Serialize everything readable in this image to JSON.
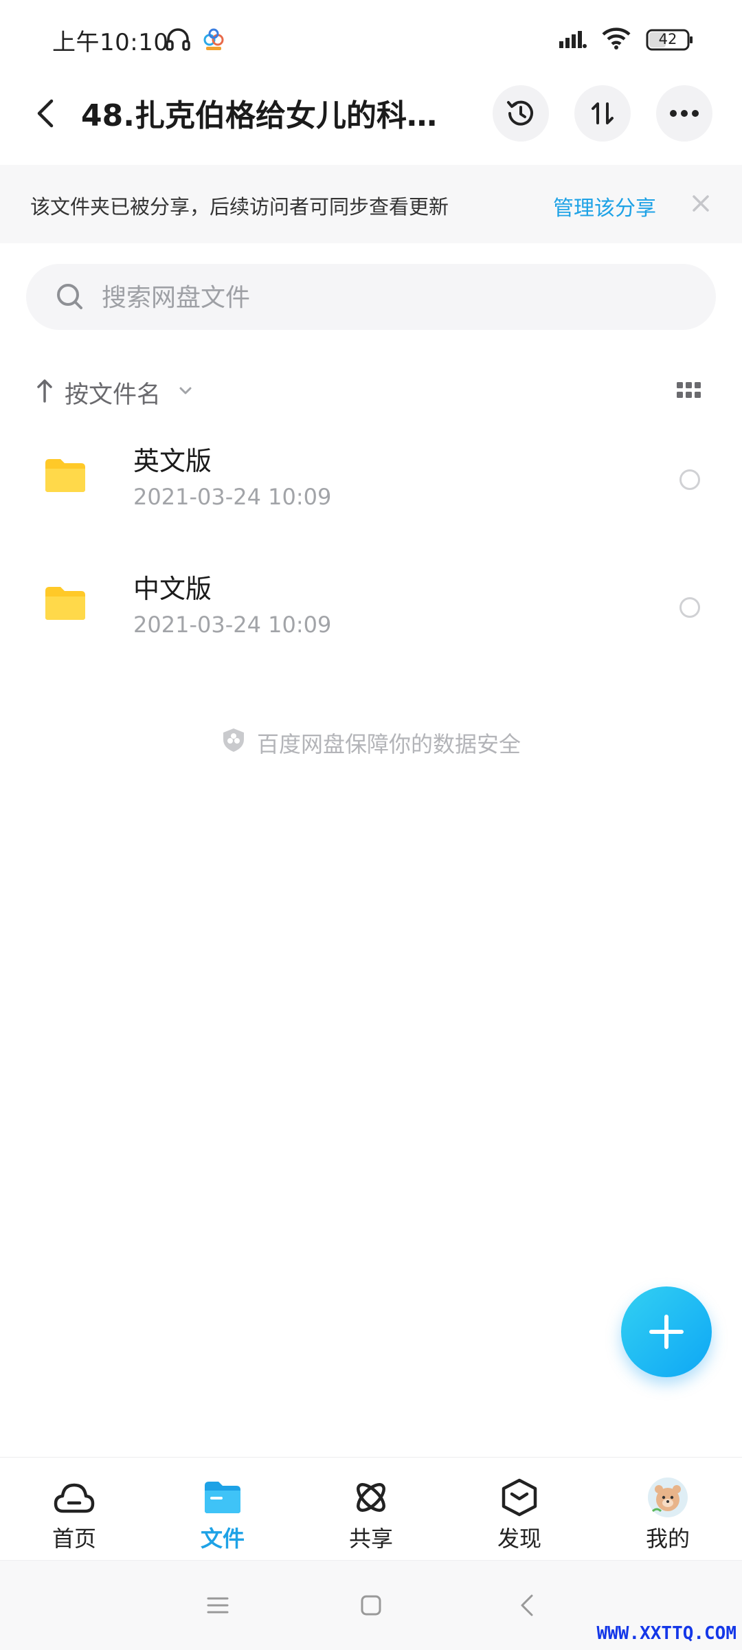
{
  "status_bar": {
    "time": "上午10:10",
    "battery": "42"
  },
  "header": {
    "title": "48.扎克伯格给女儿的科..."
  },
  "share_banner": {
    "text": "该文件夹已被分享，后续访问者可同步查看更新",
    "link": "管理该分享"
  },
  "search": {
    "placeholder": "搜索网盘文件"
  },
  "sort": {
    "label": "按文件名"
  },
  "files": [
    {
      "name": "英文版",
      "date": "2021-03-24  10:09"
    },
    {
      "name": "中文版",
      "date": "2021-03-24  10:09"
    }
  ],
  "footer_note": "百度网盘保障你的数据安全",
  "bottom_nav": {
    "items": [
      {
        "label": "首页",
        "icon": "cloud-icon"
      },
      {
        "label": "文件",
        "icon": "folder-icon"
      },
      {
        "label": "共享",
        "icon": "atom-icon"
      },
      {
        "label": "发现",
        "icon": "box-icon"
      },
      {
        "label": "我的",
        "icon": "avatar-icon"
      }
    ],
    "active_index": 1
  },
  "watermark": "WWW.XXTTQ.COM",
  "colors": {
    "accent": "#1ea2e6",
    "folder": "#ffd43b",
    "fab": "#0ea7f5"
  }
}
